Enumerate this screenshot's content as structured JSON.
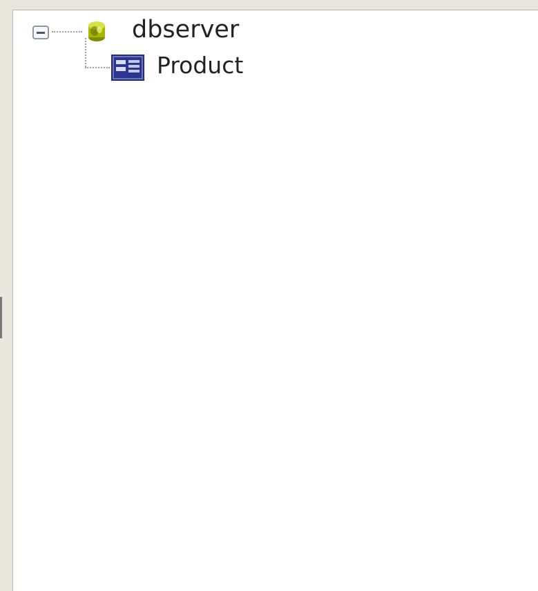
{
  "tree": {
    "root": {
      "label": "dbserver",
      "icon": "database-icon",
      "expanded": true
    },
    "children": [
      {
        "label": "Product",
        "icon": "table-icon"
      }
    ]
  },
  "colors": {
    "panel_background": "#ffffff",
    "window_background": "#ece9d8",
    "expander_border": "#8d96a6",
    "table_icon_blue": "#1f2a8a",
    "database_icon_yellow": "#b8c400"
  }
}
